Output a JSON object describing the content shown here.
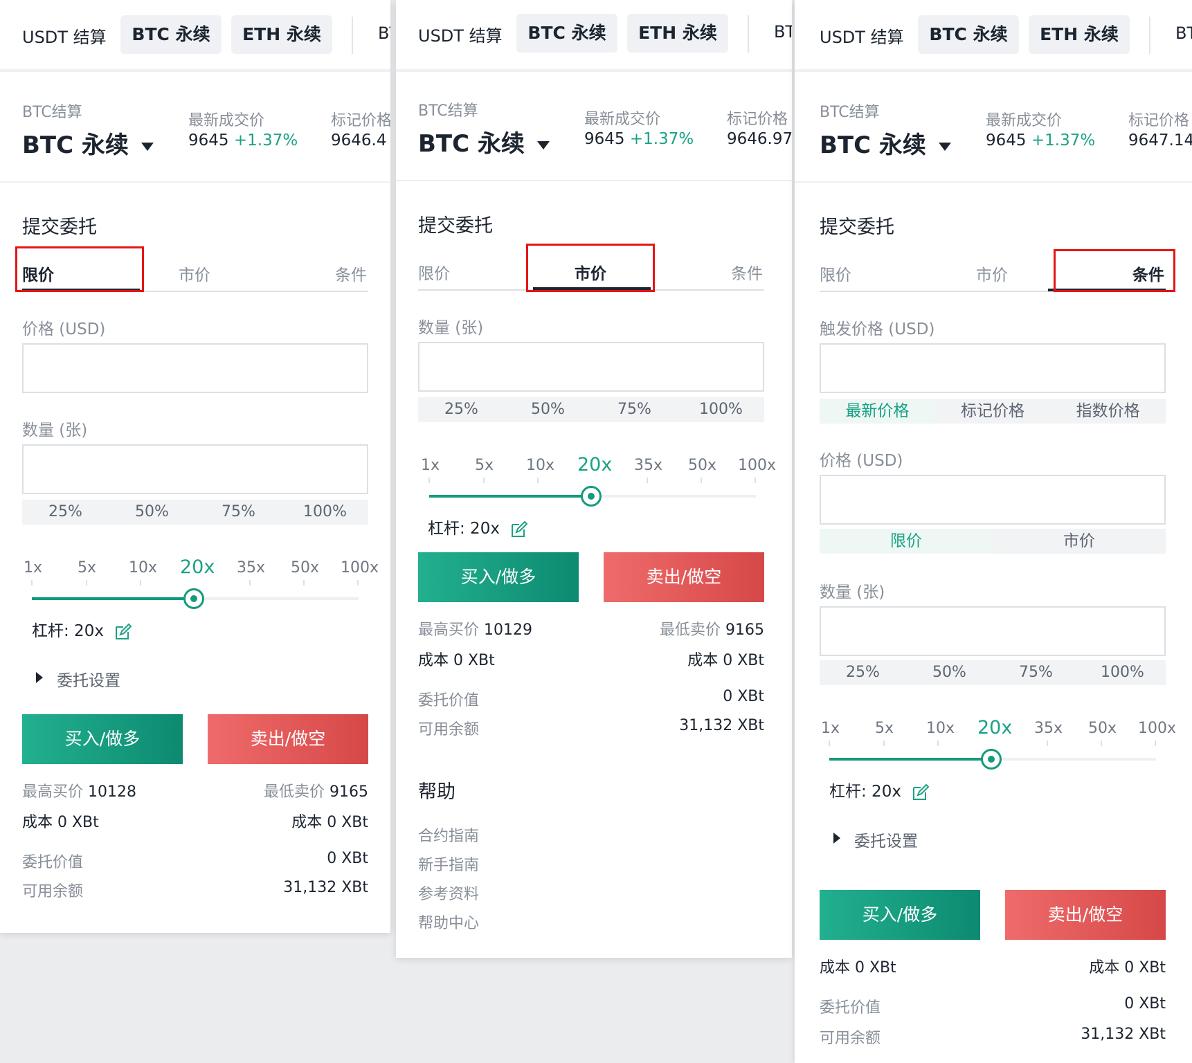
{
  "colors": {
    "accent": "#149a7d",
    "sell": "#d64848",
    "highlight": "#e51515"
  },
  "top_tabs": {
    "usdt": "USDT 结算",
    "btc": "BTC 永续",
    "eth": "ETH 永续",
    "more": "BT"
  },
  "header": {
    "settle": "BTC结算",
    "symbol": "BTC 永续",
    "last_label": "最新成交价",
    "last_price": "9645",
    "change": "+1.37%",
    "mark_label": "标记价格",
    "mark_p1": "9646.4",
    "mark_p2": "9646.97",
    "mark_p3": "9647.14"
  },
  "order": {
    "title": "提交委托",
    "tabs": {
      "limit": "限价",
      "market": "市价",
      "conditional": "条件"
    },
    "price_label": "价格 (USD)",
    "trigger_label": "触发价格 (USD)",
    "qty_label": "数量 (张)",
    "pcts": [
      "25%",
      "50%",
      "75%",
      "100%"
    ],
    "trigger_types": [
      "最新价格",
      "标记价格",
      "指数价格"
    ],
    "exec_types": [
      "限价",
      "市价"
    ],
    "leverage_opts": [
      "1x",
      "5x",
      "10x",
      "20x",
      "35x",
      "50x",
      "100x"
    ],
    "leverage_selected": "20x",
    "leverage_label": "杠杆: 20x",
    "settings": "委托设置",
    "buy": "买入/做多",
    "sell": "卖出/做空"
  },
  "summary": {
    "best_bid_label": "最高买价",
    "best_bid_1": "10128",
    "best_bid_2": "10129",
    "best_ask_label": "最低卖价",
    "best_ask": "9165",
    "cost": "成本 0 XBt",
    "order_value_label": "委托价值",
    "order_value": "0 XBt",
    "balance_label": "可用余额",
    "balance": "31,132 XBt"
  },
  "help": {
    "title": "帮助",
    "links": [
      "合约指南",
      "新手指南",
      "参考资料",
      "帮助中心"
    ]
  }
}
